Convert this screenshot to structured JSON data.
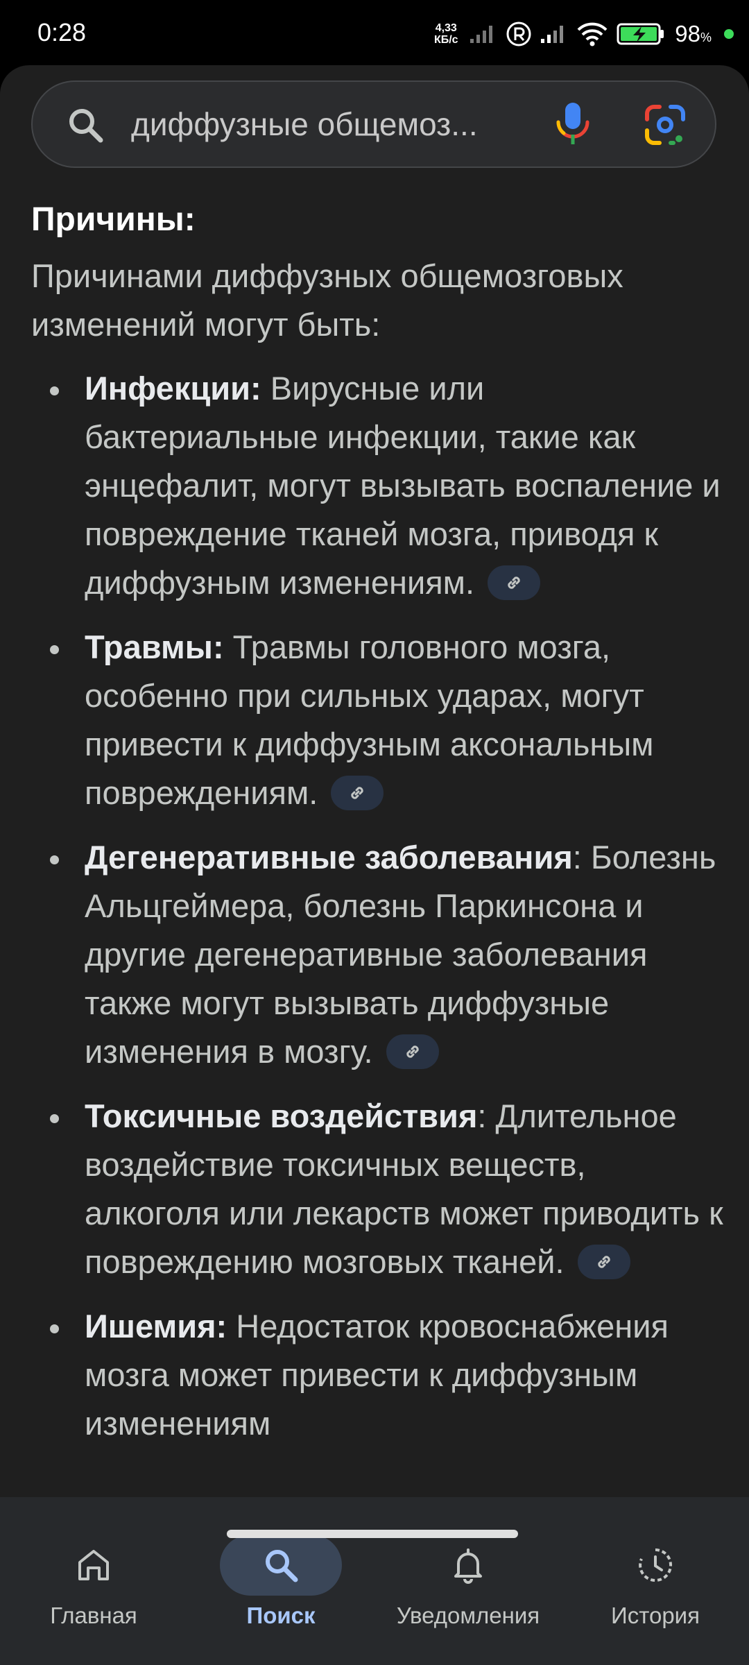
{
  "status_bar": {
    "time": "0:28",
    "speed_value": "4,33",
    "speed_unit": "КБ/с",
    "battery_percent": "98",
    "battery_unit": "%",
    "icons": [
      "signal-icon",
      "registered-icon",
      "signal-icon",
      "wifi-icon",
      "battery-charging-icon",
      "dot-indicator"
    ]
  },
  "search": {
    "query": "диффузные общемоз...",
    "icons": [
      "search-icon",
      "mic-icon",
      "google-lens-icon"
    ]
  },
  "article": {
    "heading": "Причины:",
    "intro": "Причинами диффузных общемозговых изменений могут быть:",
    "causes": [
      {
        "term": "Инфекции:",
        "text": " Вирусные или бактериальные инфекции, такие как энцефалит, могут вызывать воспаление и повреждение тканей мозга, приводя к диффузным изменениям."
      },
      {
        "term": "Травмы:",
        "text": " Травмы головного мозга, особенно при сильных ударах, могут привести к диффузным аксональным повреждениям."
      },
      {
        "term": "Дегенеративные заболевания",
        "text": ": Болезнь Альцгеймера, болезнь Паркинсона и другие дегенеративные заболевания также могут вызывать диффузные изменения в мозгу."
      },
      {
        "term": "Токсичные воздействия",
        "text": ": Длительное воздействие токсичных веществ, алкоголя или лекарств может приводить к повреждению мозговых тканей."
      },
      {
        "term": "Ишемия:",
        "text": " Недостаток кровоснабжения мозга может привести к диффузным изменениям"
      }
    ]
  },
  "bottom_nav": {
    "items": [
      {
        "label": "Главная",
        "icon": "home-icon"
      },
      {
        "label": "Поиск",
        "icon": "search-icon",
        "active": true
      },
      {
        "label": "Уведомления",
        "icon": "bell-icon"
      },
      {
        "label": "История",
        "icon": "history-icon"
      }
    ]
  },
  "colors": {
    "background": "#1f1f1f",
    "accent": "#a8c7fa",
    "active_pill": "#3a4658",
    "link_chip": "#283243"
  }
}
